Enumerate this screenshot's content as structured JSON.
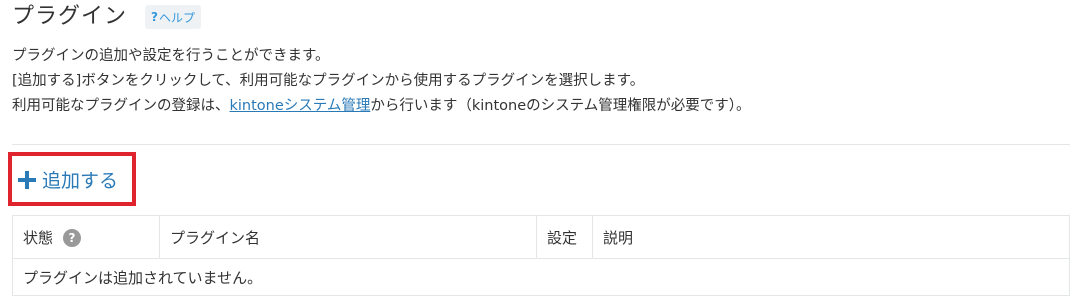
{
  "page": {
    "title": "プラグイン",
    "help_icon": "?",
    "help_label": "ヘルプ"
  },
  "description": {
    "line1": "プラグインの追加や設定を行うことができます。",
    "line2": "[追加する]ボタンをクリックして、利用可能なプラグインから使用するプラグインを選択します。",
    "line3_before": "利用可能なプラグインの登録は、",
    "line3_link": "kintoneシステム管理",
    "line3_after": "から行います（kintoneのシステム管理権限が必要です）。"
  },
  "toolbar": {
    "add_label": "追加する",
    "add_icon": "plus-icon",
    "highlight_color": "#e0242d"
  },
  "table": {
    "headers": {
      "status": "状態",
      "status_help_icon": "?",
      "name": "プラグイン名",
      "setting": "設定",
      "description": "説明"
    },
    "empty_message": "プラグインは追加されていません。"
  },
  "colors": {
    "accent": "#2a7ab8",
    "text": "#333333",
    "border": "#e3e7e8"
  }
}
